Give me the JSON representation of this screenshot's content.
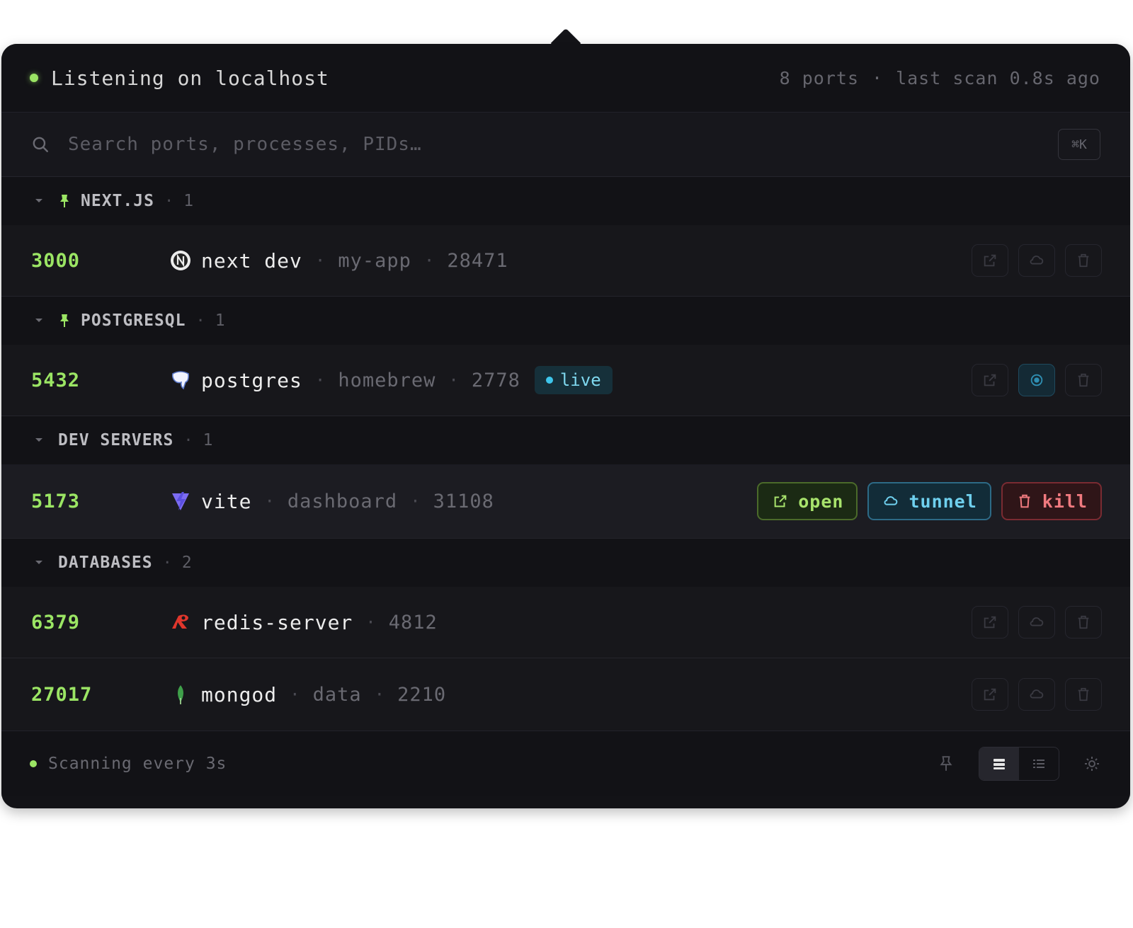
{
  "header": {
    "title": "Listening on localhost",
    "port_count": "8 ports",
    "sep": "·",
    "last_scan": "last scan 0.8s ago"
  },
  "search": {
    "placeholder": "Search ports, processes, PIDs…",
    "shortcut": "⌘K"
  },
  "sep": "·",
  "groups": [
    {
      "name": "NEXT.JS",
      "count": "1",
      "pinned": true,
      "rows": [
        {
          "port": "3000",
          "icon": "nextjs-icon",
          "process": "next dev",
          "project": "my-app",
          "pid": "28471"
        }
      ]
    },
    {
      "name": "POSTGRESQL",
      "count": "1",
      "pinned": true,
      "rows": [
        {
          "port": "5432",
          "icon": "postgres-icon",
          "process": "postgres",
          "project": "homebrew",
          "pid": "2778",
          "badge": "live"
        }
      ]
    },
    {
      "name": "DEV SERVERS",
      "count": "1",
      "pinned": false,
      "rows": [
        {
          "port": "5173",
          "icon": "vite-icon",
          "process": "vite",
          "project": "dashboard",
          "pid": "31108",
          "actions": {
            "open": "open",
            "tunnel": "tunnel",
            "kill": "kill"
          }
        }
      ]
    },
    {
      "name": "DATABASES",
      "count": "2",
      "pinned": false,
      "rows": [
        {
          "port": "6379",
          "icon": "redis-icon",
          "process": "redis-server",
          "pid": "4812"
        },
        {
          "port": "27017",
          "icon": "mongodb-icon",
          "process": "mongod",
          "project": "data",
          "pid": "2210"
        }
      ]
    }
  ],
  "footer": {
    "status": "Scanning every 3s",
    "view_mode": "comfortable"
  },
  "colors": {
    "accent_green": "#9be564",
    "accent_cyan": "#6fd0ee",
    "danger_red": "#f07a7f",
    "background": "#131317"
  }
}
